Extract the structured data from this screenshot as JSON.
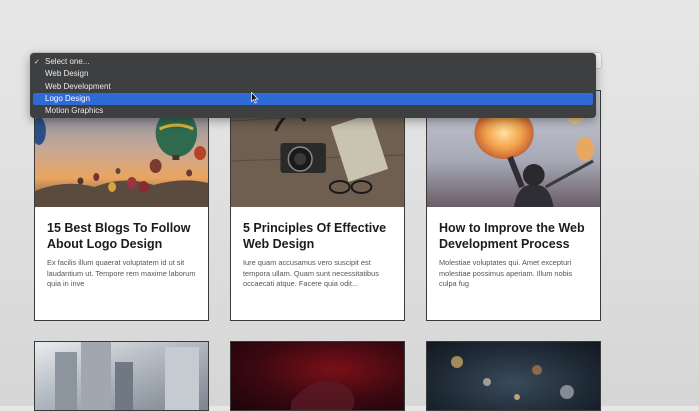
{
  "dropdown": {
    "options": [
      {
        "label": "Select one...",
        "selected": true
      },
      {
        "label": "Web Design"
      },
      {
        "label": "Web Development"
      },
      {
        "label": "Logo Design",
        "highlighted": true
      },
      {
        "label": "Motion Graphics"
      }
    ],
    "highlight_color": "#2f6bd6",
    "menu_bg": "#3e3f41"
  },
  "cards": [
    {
      "title": "15 Best Blogs To Follow About Logo Design",
      "excerpt": "Ex facilis illum quaerat voluptatem id ut sit laudantium ut. Tempore rem maxime laborum quia in inve"
    },
    {
      "title": "5 Principles Of Effective Web Design",
      "excerpt": "Iure quam accusamus vero suscipit est tempora ullam. Quam sunt necessitatibus occaecati atque. Facere quia odit..."
    },
    {
      "title": "How to Improve the Web Development Process",
      "excerpt": "Molestiae voluptates qui. Amet excepturi molestiae possimus aperiam. Illum nobis culpa fug"
    }
  ],
  "icons": {
    "check": "check-icon",
    "chevron": "chevron-down-icon",
    "cursor": "mouse-cursor-icon"
  }
}
